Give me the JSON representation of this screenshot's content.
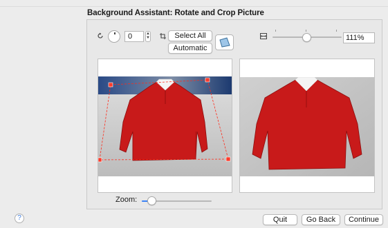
{
  "title": "Background Assistant: Rotate and Crop Picture",
  "toolbar": {
    "rotation_value": "0",
    "select_all_label": "Select All",
    "automatic_label": "Automatic",
    "zoom_percent": "111%"
  },
  "icons": {
    "rotate": "rotate-icon",
    "crop": "crop-icon",
    "perspective": "perspective-icon",
    "fit": "fit-to-window-icon",
    "help": "?"
  },
  "zoom": {
    "label": "Zoom:",
    "level": 0.1
  },
  "top_zoom_level": 0.45,
  "buttons": {
    "quit": "Quit",
    "go_back": "Go Back",
    "continue": "Continue"
  },
  "colors": {
    "accent": "#3a82f7",
    "shirt": "#c81a1a",
    "crop_line": "#ff2a1a",
    "background_left": "#1f3f74"
  }
}
